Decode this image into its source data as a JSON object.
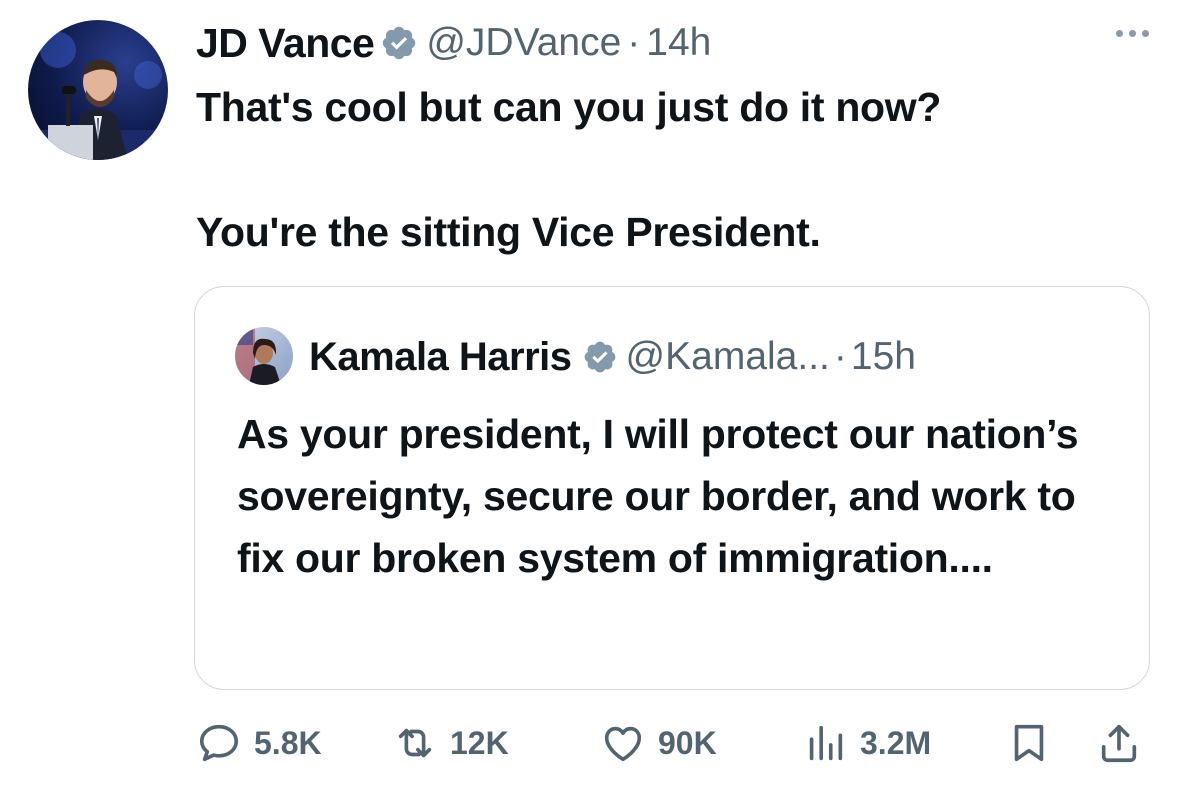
{
  "tweet": {
    "author_name": "JD Vance",
    "author_handle": "@JDVance",
    "separator": "·",
    "time": "14h",
    "text_line1": "That's cool but can you just do it now?",
    "text_line2": "You're the sitting Vice President."
  },
  "quoted": {
    "author_name": "Kamala Harris",
    "author_handle": "@Kamala...",
    "separator": "·",
    "time": "15h",
    "text": "As your president, I will protect our nation’s sovereignty, secure our border, and work to fix our broken system of immigration...."
  },
  "actions": {
    "replies": "5.8K",
    "reposts": "12K",
    "likes": "90K",
    "views": "3.2M"
  },
  "icons": {
    "verified": "verified-badge-icon",
    "more": "more-options-icon",
    "reply": "reply-icon",
    "repost": "repost-icon",
    "like": "heart-icon",
    "views": "views-icon",
    "bookmark": "bookmark-icon",
    "share": "share-icon"
  },
  "colors": {
    "badge": "#829aab",
    "muted": "#536471",
    "border": "#cfd9de"
  }
}
